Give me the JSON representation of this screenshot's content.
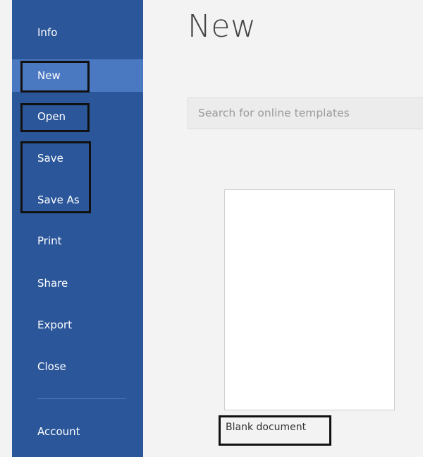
{
  "window": {
    "title": "New"
  },
  "sidebar": {
    "items": [
      {
        "label": "Info"
      },
      {
        "label": "New"
      },
      {
        "label": "Open"
      },
      {
        "label": "Save"
      },
      {
        "label": "Save As"
      },
      {
        "label": "Print"
      },
      {
        "label": "Share"
      },
      {
        "label": "Export"
      },
      {
        "label": "Close"
      },
      {
        "label": "Account"
      }
    ],
    "active": "New"
  },
  "search": {
    "placeholder": "Search for online templates"
  },
  "templates": [
    {
      "label": "Blank document"
    }
  ],
  "colors": {
    "sidebar": "#2b579a",
    "active_item": "#4a78c1",
    "background": "#f3f3f3"
  }
}
